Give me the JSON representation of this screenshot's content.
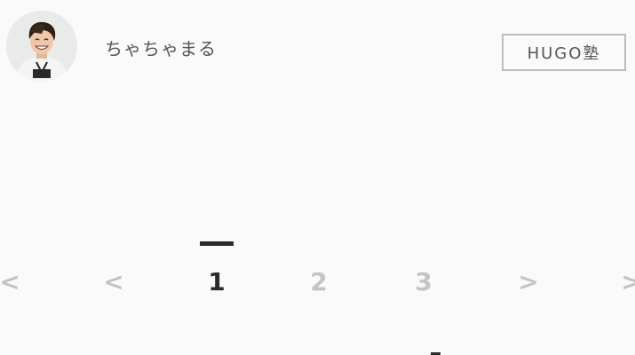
{
  "author": {
    "name": "ちゃちゃまる",
    "avatar_icon": "profile-photo"
  },
  "header": {
    "badge_label": "HUGO塾"
  },
  "pagination": {
    "first_label": "<",
    "prev_label": "<",
    "pages": [
      "1",
      "2",
      "3"
    ],
    "current_page": "1",
    "next_label": ">",
    "last_label": ">"
  },
  "colors": {
    "background": "#fafafa",
    "text": "#555555",
    "active": "#2b2b2b",
    "inactive": "#c4c4c4",
    "border": "#bcbcbc"
  }
}
